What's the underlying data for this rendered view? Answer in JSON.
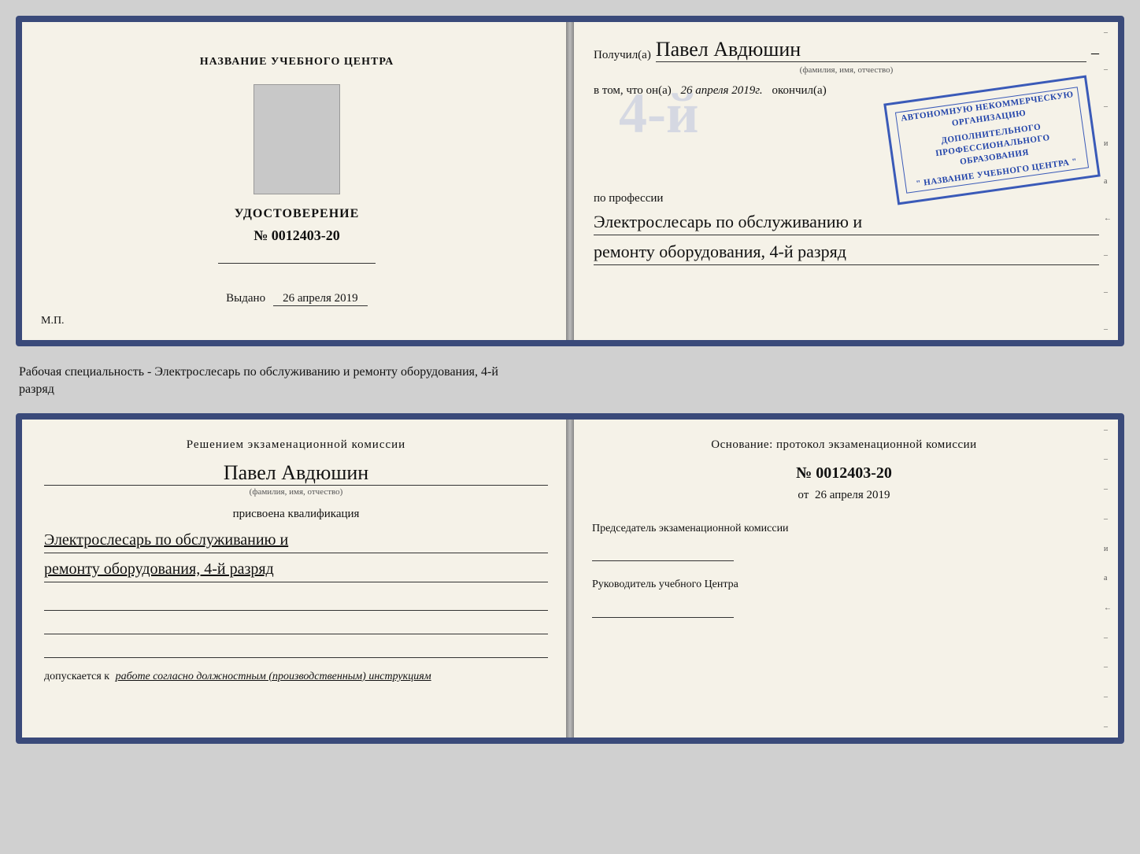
{
  "doc_top": {
    "left": {
      "org_name": "НАЗВАНИЕ УЧЕБНОГО ЦЕНТРА",
      "cert_type": "УДОСТОВЕРЕНИЕ",
      "cert_number_prefix": "№",
      "cert_number": "0012403-20",
      "issued_label": "Выдано",
      "issued_date": "26 апреля 2019",
      "mp_label": "М.П."
    },
    "right": {
      "recipient_label": "Получил(а)",
      "recipient_name": "Павел Авдюшин",
      "fio_label": "(фамилия, имя, отчество)",
      "recipient_dash": "–",
      "vtom_label": "в том, что он(а)",
      "vtom_date": "26 апреля 2019г.",
      "okonchil_label": "окончил(а)",
      "stamp_line1": "АВТОНОМНУЮ НЕКОММЕРЧЕСКУЮ ОРГАНИЗАЦИЮ",
      "stamp_line2": "ДОПОЛНИТЕЛЬНОГО ПРОФЕССИОНАЛЬНОГО ОБРАЗОВАНИЯ",
      "stamp_line3": "\" НАЗВАНИЕ УЧЕБНОГО ЦЕНТРА \"",
      "profession_label": "по профессии",
      "profession_line1": "Электрослесарь по обслуживанию и",
      "profession_line2": "ремонту оборудования, 4-й разряд"
    }
  },
  "between_text": {
    "line1": "Рабочая специальность - Электрослесарь по обслуживанию и ремонту оборудования, 4-й",
    "line2": "разряд"
  },
  "doc_bottom": {
    "left": {
      "decision_title": "Решением экзаменационной комиссии",
      "person_name": "Павел Авдюшин",
      "fio_label": "(фамилия, имя, отчество)",
      "assigned_label": "присвоена квалификация",
      "qualification_line1": "Электрослесарь по обслуживанию и",
      "qualification_line2": "ремонту оборудования, 4-й разряд",
      "допуск_label": "допускается к",
      "допуск_text": "работе согласно должностным (производственным) инструкциям"
    },
    "right": {
      "basis_title": "Основание: протокол экзаменационной комиссии",
      "protocol_prefix": "№",
      "protocol_number": "0012403-20",
      "date_prefix": "от",
      "protocol_date": "26 апреля 2019",
      "chairman_label": "Председатель экзаменационной комиссии",
      "director_label": "Руководитель учебного Центра"
    }
  },
  "side_chars": {
    "top_right": [
      "–",
      "–",
      "–",
      "и",
      "а",
      "←",
      "–",
      "–",
      "–"
    ],
    "bottom_right": [
      "–",
      "–",
      "–",
      "–",
      "и",
      "а",
      "←",
      "–",
      "–",
      "–",
      "–"
    ]
  }
}
